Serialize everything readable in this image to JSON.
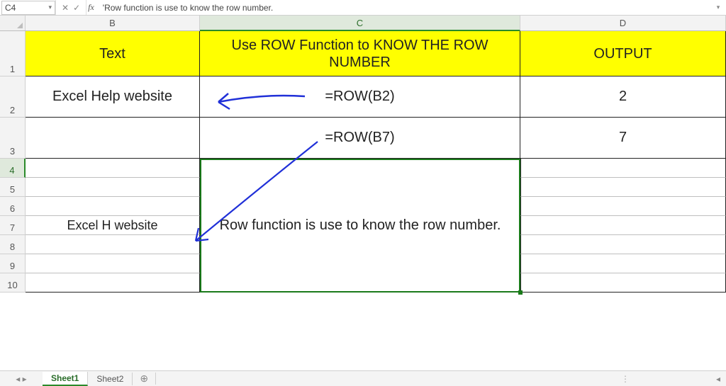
{
  "formula_bar": {
    "cell_ref": "C4",
    "cancel_glyph": "✕",
    "accept_glyph": "✓",
    "fx_label": "fx",
    "formula_text": "'Row function is use to know the row number."
  },
  "columns": {
    "B": "B",
    "C": "C",
    "D": "D"
  },
  "rows": [
    "1",
    "2",
    "3",
    "4",
    "5",
    "6",
    "7",
    "8",
    "9",
    "10"
  ],
  "header_row": {
    "B": "Text",
    "C": "Use ROW Function to KNOW THE ROW NUMBER",
    "D": "OUTPUT"
  },
  "data": {
    "r2": {
      "B": "Excel Help website",
      "C": "=ROW(B2)",
      "D": "2"
    },
    "r3": {
      "B": "",
      "C": "=ROW(B7)",
      "D": "7"
    },
    "r7": {
      "B": "Excel H website"
    }
  },
  "merged_note": "Row function is use to know the row number.",
  "sheet_tabs": {
    "active": "Sheet1",
    "other": "Sheet2",
    "add_glyph": "⊕"
  },
  "chart_data": {
    "type": "table",
    "title": "Use ROW Function to KNOW THE ROW NUMBER",
    "columns": [
      "Text",
      "Use ROW Function to KNOW THE ROW NUMBER",
      "OUTPUT"
    ],
    "rows": [
      [
        "Excel Help website",
        "=ROW(B2)",
        2
      ],
      [
        "",
        "=ROW(B7)",
        7
      ]
    ],
    "note": "Row function is use to know the row number."
  }
}
